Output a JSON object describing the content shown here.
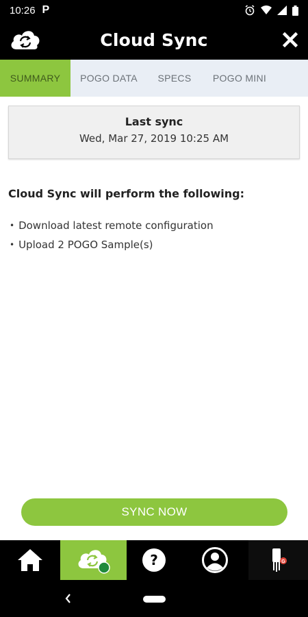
{
  "status_bar": {
    "time": "10:26",
    "app_icon": "P",
    "icons": [
      "alarm-icon",
      "wifi-icon",
      "signal-icon",
      "battery-icon"
    ]
  },
  "header": {
    "title": "Cloud Sync",
    "left_icon": "cloud-sync-icon",
    "right_icon": "close-icon"
  },
  "tabs": [
    {
      "label": "SUMMARY",
      "active": true
    },
    {
      "label": "POGO DATA",
      "active": false
    },
    {
      "label": "SPECS",
      "active": false
    },
    {
      "label": "POGO MINI",
      "active": false
    }
  ],
  "last_sync": {
    "label": "Last sync",
    "value": "Wed, Mar 27, 2019 10:25 AM"
  },
  "summary": {
    "intro": "Cloud Sync will perform the following:",
    "tasks": [
      "Download latest remote configuration",
      "Upload 2 POGO Sample(s)"
    ]
  },
  "actions": {
    "sync_label": "SYNC NOW"
  },
  "bottom_nav": [
    {
      "icon": "home-icon",
      "active": false
    },
    {
      "icon": "cloud-sync-icon",
      "active": true
    },
    {
      "icon": "help-icon",
      "active": false
    },
    {
      "icon": "profile-icon",
      "active": false
    },
    {
      "icon": "meter-icon",
      "active": false
    }
  ],
  "colors": {
    "accent": "#8dc63f",
    "tab_bar": "#e9eef5",
    "status_dot": "#1f8a3b"
  }
}
